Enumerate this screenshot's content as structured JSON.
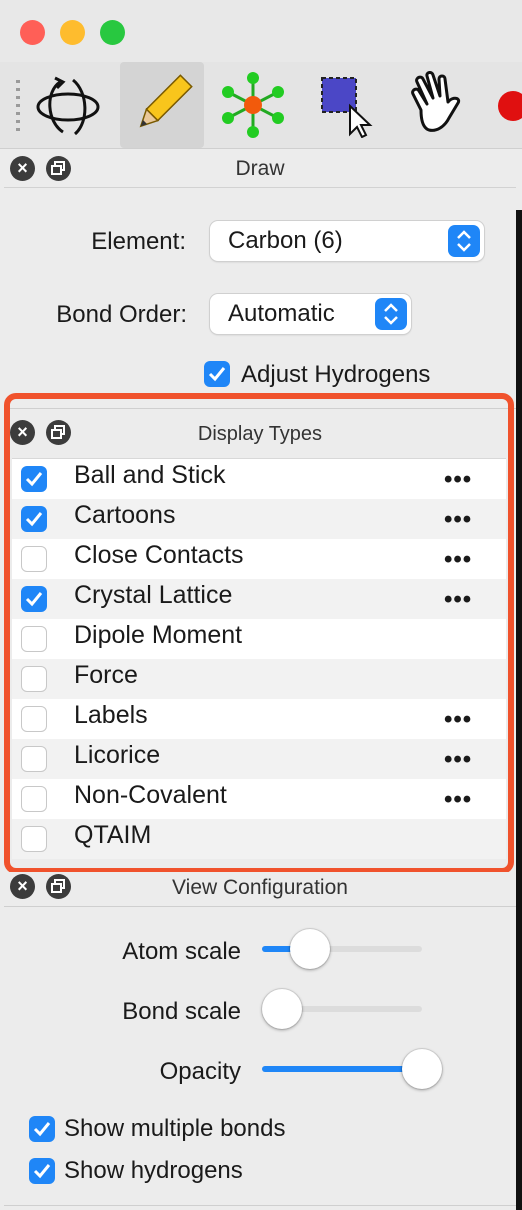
{
  "window": {
    "traffic_lights": [
      "close",
      "minimize",
      "zoom"
    ]
  },
  "toolbar": {
    "tools": [
      "rotate-tool-icon",
      "pencil-draw-icon",
      "manipulate-atoms-icon",
      "select-tool-icon",
      "hand-navigate-icon",
      "record-icon"
    ],
    "selected_index": 1
  },
  "draw_panel": {
    "title": "Draw",
    "element_label": "Element:",
    "element_value": "Carbon (6)",
    "bond_order_label": "Bond Order:",
    "bond_order_value": "Automatic",
    "adjust_hydrogens_label": "Adjust Hydrogens",
    "adjust_hydrogens_checked": true
  },
  "display_types": {
    "title": "Display Types",
    "items": [
      {
        "label": "Ball and Stick",
        "checked": true,
        "has_options": true,
        "options_label": "•••"
      },
      {
        "label": "Cartoons",
        "checked": true,
        "has_options": true,
        "options_label": "•••"
      },
      {
        "label": "Close Contacts",
        "checked": false,
        "has_options": true,
        "options_label": "•••"
      },
      {
        "label": "Crystal Lattice",
        "checked": true,
        "has_options": true,
        "options_label": "•••"
      },
      {
        "label": "Dipole Moment",
        "checked": false,
        "has_options": false,
        "options_label": ""
      },
      {
        "label": "Force",
        "checked": false,
        "has_options": false,
        "options_label": ""
      },
      {
        "label": "Labels",
        "checked": false,
        "has_options": true,
        "options_label": "•••"
      },
      {
        "label": "Licorice",
        "checked": false,
        "has_options": true,
        "options_label": "•••"
      },
      {
        "label": "Non-Covalent",
        "checked": false,
        "has_options": true,
        "options_label": "•••"
      },
      {
        "label": "QTAIM",
        "checked": false,
        "has_options": false,
        "options_label": ""
      }
    ]
  },
  "view_configuration": {
    "title": "View Configuration",
    "atom_scale_label": "Atom scale",
    "atom_scale_value": 0.3,
    "bond_scale_label": "Bond scale",
    "bond_scale_value": 0.0,
    "opacity_label": "Opacity",
    "opacity_value": 1.0,
    "show_multiple_bonds_label": "Show multiple bonds",
    "show_multiple_bonds_checked": true,
    "show_hydrogens_label": "Show hydrogens",
    "show_hydrogens_checked": true
  },
  "colors": {
    "accent": "#1f86f7",
    "highlight": "#f0522c",
    "close": "#ff5f57",
    "minimize": "#febc2e",
    "zoom": "#28c840"
  }
}
